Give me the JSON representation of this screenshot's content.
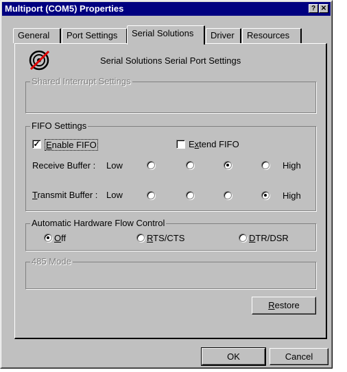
{
  "window": {
    "title": "Multiport (COM5) Properties",
    "help_button": "?",
    "close_button": "✕"
  },
  "tabs": [
    {
      "label": "General"
    },
    {
      "label": "Port Settings"
    },
    {
      "label": "Serial Solutions",
      "selected": true
    },
    {
      "label": "Driver"
    },
    {
      "label": "Resources"
    }
  ],
  "header": {
    "title": "Serial Solutions Serial Port Settings",
    "icon": "no-signal-icon"
  },
  "shared_interrupt": {
    "label": "Shared Interrupt Settings"
  },
  "fifo": {
    "label": "FIFO Settings",
    "enable": {
      "label_underlined": "E",
      "label_rest": "nable FIFO",
      "checked": true
    },
    "extend": {
      "label_underlined": "x",
      "label_prefix": "E",
      "label_rest": "tend FIFO",
      "checked": false
    },
    "receive": {
      "label": "Receive Buffer :",
      "low": "Low",
      "high": "High",
      "selected_index": 2
    },
    "transmit": {
      "label_underlined": "T",
      "label_rest": "ransmit Buffer :",
      "low": "Low",
      "high": "High",
      "selected_index": 3
    }
  },
  "flow": {
    "label": "Automatic Hardware Flow Control",
    "options": [
      {
        "underlined": "O",
        "rest": "ff",
        "selected": true
      },
      {
        "underlined": "R",
        "rest": "TS/CTS",
        "selected": false
      },
      {
        "underlined": "D",
        "rest": "TR/DSR",
        "selected": false
      }
    ]
  },
  "mode485": {
    "label": "485 Mode"
  },
  "buttons": {
    "restore_underlined": "R",
    "restore_rest": "estore",
    "ok": "OK",
    "cancel": "Cancel"
  }
}
